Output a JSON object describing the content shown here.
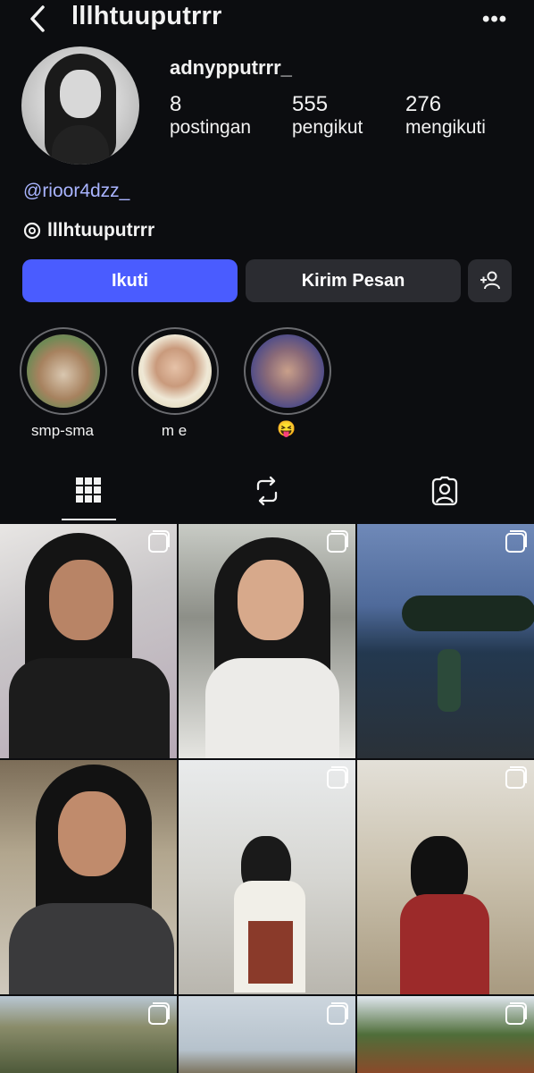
{
  "header": {
    "back_icon": "chevron-left-icon",
    "title": "lllhtuuputrrr",
    "more_icon": "more-horizontal-icon",
    "more_glyph": "•••"
  },
  "profile": {
    "username": "adnypputrrr_",
    "stats": [
      {
        "count": "8",
        "label": "postingan"
      },
      {
        "count": "555",
        "label": "pengikut"
      },
      {
        "count": "276",
        "label": "mengikuti"
      }
    ],
    "mention": "@rioor4dzz_",
    "threads_handle": "lllhtuuputrrr",
    "threads_icon": "threads-icon"
  },
  "actions": {
    "follow_label": "Ikuti",
    "message_label": "Kirim Pesan",
    "add_user_icon": "add-user-icon"
  },
  "highlights": [
    {
      "label": "smp-sma"
    },
    {
      "label": "m e"
    },
    {
      "label": "😝"
    }
  ],
  "tabs": [
    {
      "name": "grid",
      "icon": "grid-icon",
      "active": true
    },
    {
      "name": "reels",
      "icon": "repost-icon",
      "active": false
    },
    {
      "name": "tagged",
      "icon": "tagged-icon",
      "active": false
    }
  ],
  "posts": [
    {
      "multi": true
    },
    {
      "multi": true
    },
    {
      "multi": true
    },
    {
      "multi": false
    },
    {
      "multi": true
    },
    {
      "multi": true
    },
    {
      "multi": true
    },
    {
      "multi": true
    },
    {
      "multi": true
    }
  ],
  "colors": {
    "background": "#0c0d10",
    "follow_button": "#4a5cff",
    "secondary_button": "#2b2c31",
    "mention_link": "#a9b4ff"
  }
}
